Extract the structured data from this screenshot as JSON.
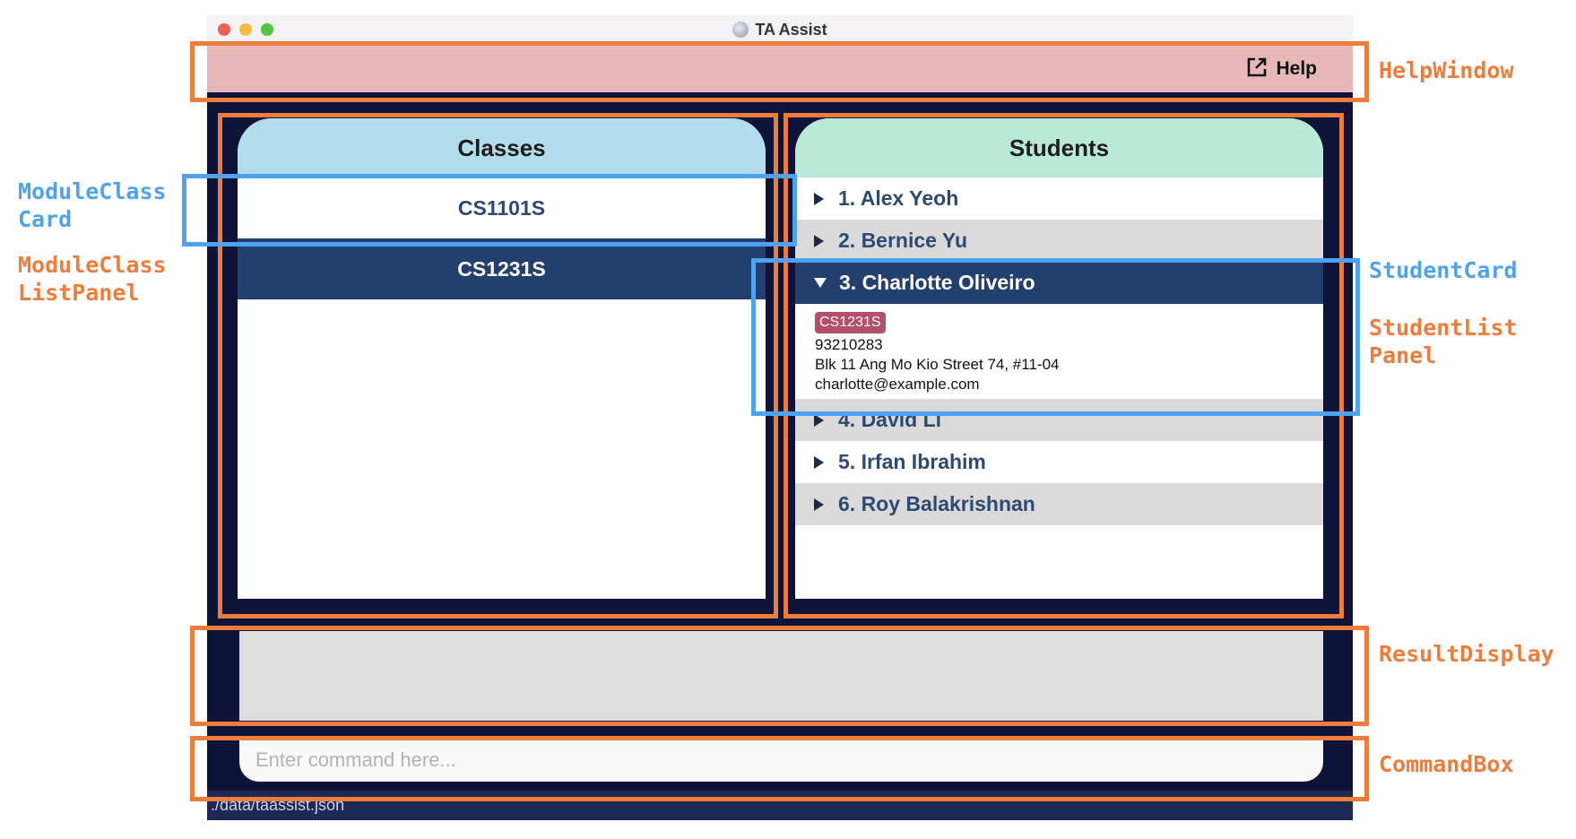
{
  "window": {
    "title": "TA Assist",
    "traffic_lights": [
      "#ee5f57",
      "#f5bd3b",
      "#4ec63f"
    ]
  },
  "help": {
    "label": "Help",
    "icon": "external-link-icon"
  },
  "classes_panel": {
    "title": "Classes",
    "items": [
      {
        "code": "CS1101S",
        "selected": false
      },
      {
        "code": "CS1231S",
        "selected": true
      }
    ]
  },
  "students_panel": {
    "title": "Students",
    "items": [
      {
        "label": "1. Alex Yeoh",
        "expanded": false
      },
      {
        "label": "2. Bernice Yu",
        "expanded": false
      },
      {
        "label": "3. Charlotte Oliveiro",
        "expanded": true,
        "tag": "CS1231S",
        "phone": "93210283",
        "address": "Blk 11 Ang Mo Kio Street 74, #11-04",
        "email": "charlotte@example.com"
      },
      {
        "label": "4. David Li",
        "expanded": false
      },
      {
        "label": "5. Irfan Ibrahim",
        "expanded": false
      },
      {
        "label": "6. Roy Balakrishnan",
        "expanded": false
      }
    ]
  },
  "result_display": {
    "text": ""
  },
  "command_box": {
    "placeholder": "Enter command here...",
    "value": ""
  },
  "status_bar": {
    "path": "./data/taassist.json"
  },
  "annotations": {
    "help_window": "HelpWindow",
    "module_class_card": "ModuleClass\nCard",
    "module_class_list_panel": "ModuleClass\nListPanel",
    "student_card": "StudentCard",
    "student_list_panel": "StudentList\nPanel",
    "result_display": "ResultDisplay",
    "command_box": "CommandBox"
  },
  "colors": {
    "annotation_orange": "#ee7d3b",
    "annotation_blue": "#4fa2ef",
    "window_bg": "#0e1437",
    "selected": "#233f6e",
    "tag": "#b4506a"
  }
}
